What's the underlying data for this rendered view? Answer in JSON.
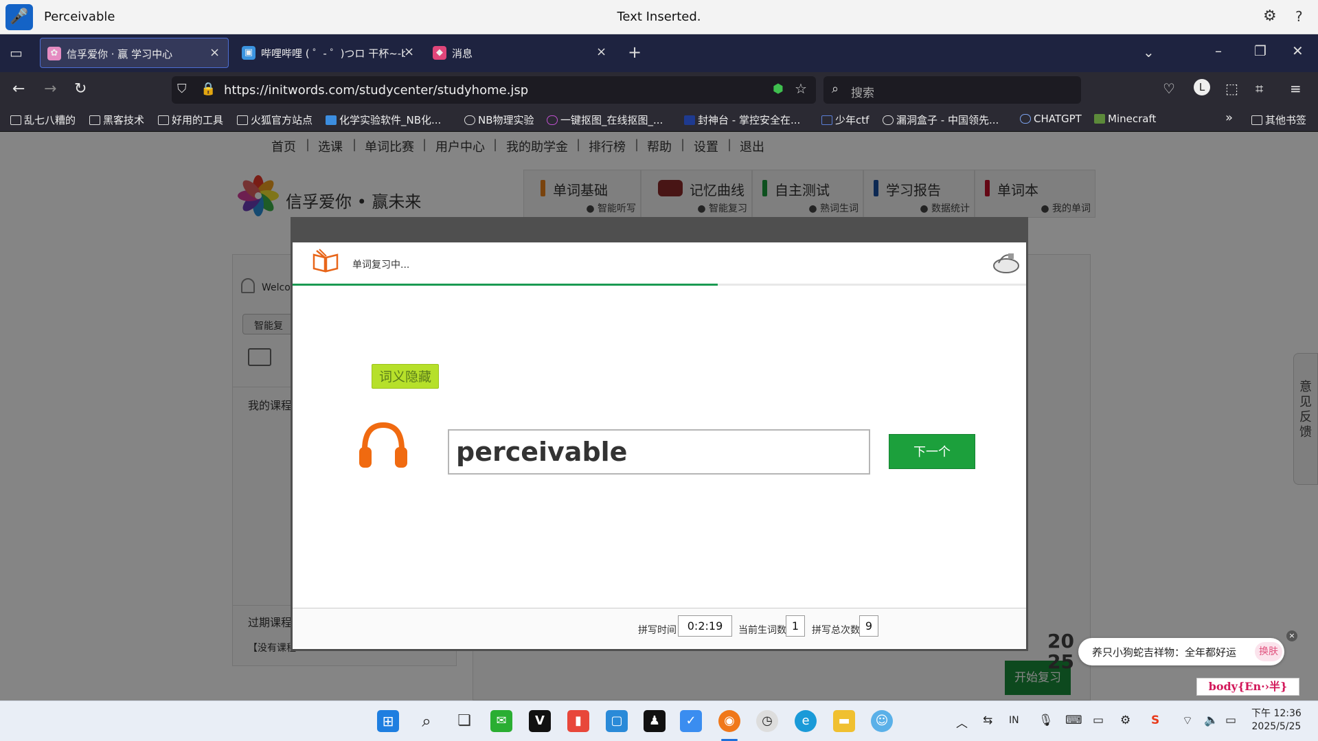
{
  "dictation": {
    "app_name": "Perceivable",
    "status": "Text Inserted."
  },
  "tabs": [
    {
      "title": "信孚爱你 · 赢 学习中心",
      "active": true
    },
    {
      "title": "哔哩哔哩 ( ゜- ゜)つロ 干杯~-bil",
      "active": false
    },
    {
      "title": "消息",
      "active": false
    }
  ],
  "address": {
    "url": "https://initwords.com/studycenter/studyhome.jsp",
    "search_placeholder": "搜索"
  },
  "bookmarks": [
    "乱七八糟的",
    "黑客技术",
    "好用的工具",
    "火狐官方站点",
    "化学实验软件_NB化...",
    "NB物理实验",
    "一键抠图_在线抠图_...",
    "封神台 - 掌控安全在...",
    "少年ctf",
    "漏洞盒子 - 中国领先...",
    "CHATGPT",
    "Minecraft",
    "其他书签"
  ],
  "site": {
    "nav": [
      "首页",
      "选课",
      "单词比赛",
      "用户中心",
      "我的助学金",
      "排行榜",
      "帮助",
      "设置",
      "退出"
    ],
    "logo_text": "信孚爱你 • 赢未来",
    "big_tabs": [
      {
        "label": "单词基础",
        "sub": "● 智能听写",
        "color": "#e8811a"
      },
      {
        "label": "记忆曲线",
        "sub": "● 智能复习",
        "color": "#8a2a2a"
      },
      {
        "label": "自主测试",
        "sub": "● 熟词生词",
        "color": "#1a9a3a"
      },
      {
        "label": "学习报告",
        "sub": "● 数据统计",
        "color": "#1a4fa0"
      },
      {
        "label": "单词本",
        "sub": "● 我的单词",
        "color": "#c0102a"
      }
    ],
    "left_panel": {
      "welcome": "Welcor",
      "smart_review": "智能复",
      "my_courses": "我的课程",
      "expired": "过期课程",
      "none": "【没有课程"
    },
    "feedback": "意见反馈",
    "start_review": "开始复习"
  },
  "modal": {
    "title": "单词复习中...",
    "progress": 0.58,
    "tag": "词义隐藏",
    "word": "perceivable",
    "next_button": "下一个",
    "footer": {
      "time_label": "拼写时间",
      "time_value": "0:2:19",
      "new_label": "当前生词数",
      "new_value": "1",
      "total_label": "拼写总次数",
      "total_value": "9"
    }
  },
  "promo": {
    "year": "2025",
    "text": "养只小狗蛇吉祥物：全年都好运",
    "skin_button": "换肤",
    "ime_indicator": "body{En·›半}"
  },
  "taskbar": {
    "clock_time": "下午 12:36",
    "clock_date": "2025/5/25"
  }
}
